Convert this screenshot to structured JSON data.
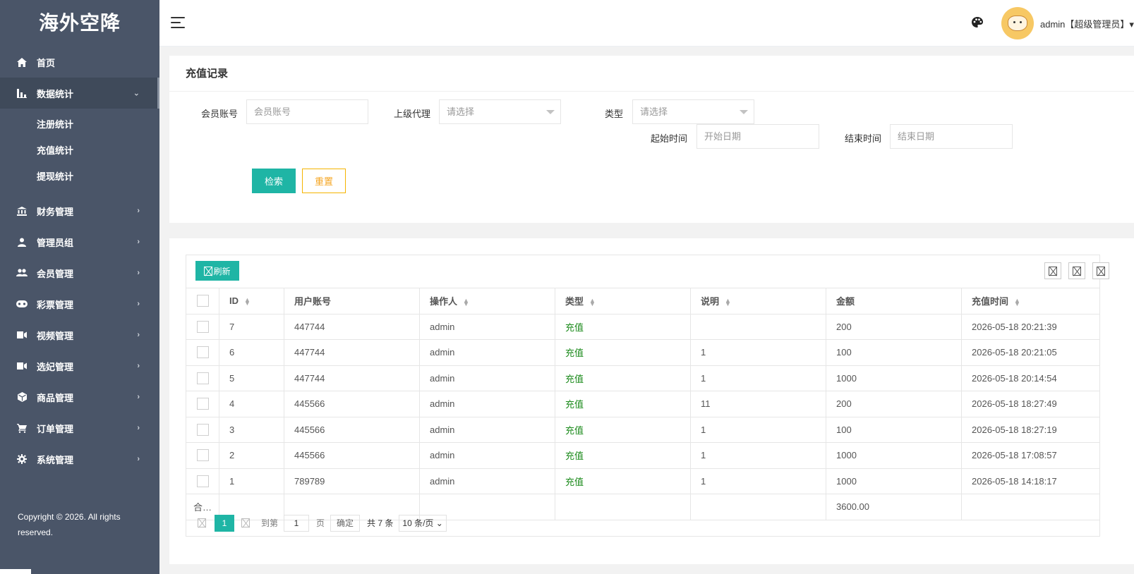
{
  "sidebar": {
    "logo": "海外空降",
    "items": [
      {
        "label": "首页",
        "icon": "home-icon"
      },
      {
        "label": "数据统计",
        "icon": "bar-chart-icon",
        "expanded": true,
        "children": [
          "注册统计",
          "充值统计",
          "提现统计"
        ]
      },
      {
        "label": "财务管理",
        "icon": "bank-icon"
      },
      {
        "label": "管理员组",
        "icon": "user-icon"
      },
      {
        "label": "会员管理",
        "icon": "users-icon"
      },
      {
        "label": "彩票管理",
        "icon": "gamepad-icon"
      },
      {
        "label": "视频管理",
        "icon": "video-icon"
      },
      {
        "label": "选妃管理",
        "icon": "video-icon"
      },
      {
        "label": "商品管理",
        "icon": "cube-icon"
      },
      {
        "label": "订单管理",
        "icon": "cart-icon"
      },
      {
        "label": "系统管理",
        "icon": "gear-icon"
      }
    ],
    "copyright": "Copyright © 2026. All rights reserved."
  },
  "header": {
    "username": "admin【超级管理员】▾"
  },
  "search": {
    "title": "充值记录",
    "account_label": "会员账号",
    "account_placeholder": "会员账号",
    "agent_label": "上级代理",
    "agent_value": "请选择",
    "type_label": "类型",
    "type_value": "请选择",
    "start_label": "起始时间",
    "start_placeholder": "开始日期",
    "end_label": "结束时间",
    "end_placeholder": "结束日期",
    "search_btn": "检索",
    "reset_btn": "重置"
  },
  "table": {
    "refresh_btn": "刷新",
    "columns": [
      "ID",
      "用户账号",
      "操作人",
      "类型",
      "说明",
      "金额",
      "充值时间"
    ],
    "rows": [
      {
        "id": "7",
        "account": "447744",
        "operator": "admin",
        "type": "充值",
        "note": "",
        "amount": "200",
        "time": "2026-05-18 20:21:39"
      },
      {
        "id": "6",
        "account": "447744",
        "operator": "admin",
        "type": "充值",
        "note": "1",
        "amount": "100",
        "time": "2026-05-18 20:21:05"
      },
      {
        "id": "5",
        "account": "447744",
        "operator": "admin",
        "type": "充值",
        "note": "1",
        "amount": "1000",
        "time": "2026-05-18 20:14:54"
      },
      {
        "id": "4",
        "account": "445566",
        "operator": "admin",
        "type": "充值",
        "note": "11",
        "amount": "200",
        "time": "2026-05-18 18:27:49"
      },
      {
        "id": "3",
        "account": "445566",
        "operator": "admin",
        "type": "充值",
        "note": "1",
        "amount": "100",
        "time": "2026-05-18 18:27:19"
      },
      {
        "id": "2",
        "account": "445566",
        "operator": "admin",
        "type": "充值",
        "note": "1",
        "amount": "1000",
        "time": "2026-05-18 17:08:57"
      },
      {
        "id": "1",
        "account": "789789",
        "operator": "admin",
        "type": "充值",
        "note": "1",
        "amount": "1000",
        "time": "2026-05-18 14:18:17"
      }
    ],
    "total_label": "合…",
    "total_amount": "3600.00"
  },
  "pager": {
    "current": "1",
    "goto_label": "到第",
    "goto_value": "1",
    "page_label": "页",
    "confirm": "确定",
    "total": "共 7 条",
    "page_size": "10 条/页"
  },
  "colors": {
    "accent": "#1fb5a5",
    "sidebar": "#4a5568",
    "reset": "#f5b400",
    "type_text": "#1b8a1b"
  }
}
